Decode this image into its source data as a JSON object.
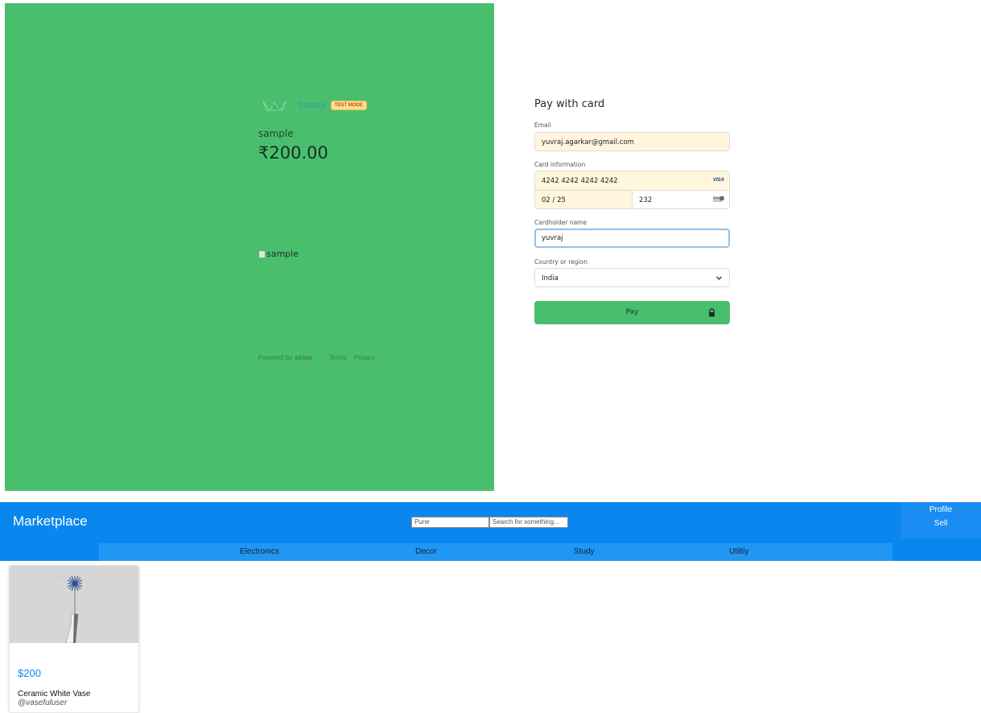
{
  "checkout": {
    "brand": {
      "back_arrow": "←",
      "name": "TOURS",
      "test_badge": "TEST MODE"
    },
    "product_name": "sample",
    "price": "₹200.00",
    "image_alt": "sample",
    "footer": {
      "powered_by": "Powered by",
      "stripe": "stripe",
      "terms": "Terms",
      "privacy": "Privacy"
    },
    "form": {
      "title": "Pay with card",
      "email_label": "Email",
      "email_value": "yuvraj.agarkar@gmail.com",
      "card_label": "Card information",
      "card_number": "4242 4242 4242 4242",
      "card_brand": "VISA",
      "expiry": "02 / 25",
      "cvc": "232",
      "name_label": "Cardholder name",
      "name_value": "yuvraj",
      "country_label": "Country or region",
      "country_value": "India",
      "pay_button": "Pay"
    },
    "colors": {
      "panel": "#49bf6e",
      "field_autofill": "#fff6dd",
      "focus_border": "#8fc1ee"
    }
  },
  "marketplace": {
    "title": "Marketplace",
    "location_value": "Pune",
    "search_placeholder": "Search for something...",
    "profile": "Profile",
    "sell": "Sell",
    "categories": [
      "Electronics",
      "Decor",
      "Study",
      "Utiltiy"
    ],
    "listing": {
      "price": "$200",
      "title": "Ceramic White Vase",
      "user": "@vasefuluser"
    },
    "colors": {
      "header": "#0a87ef",
      "category_bar": "#2196f3",
      "price": "#1187ee"
    }
  }
}
